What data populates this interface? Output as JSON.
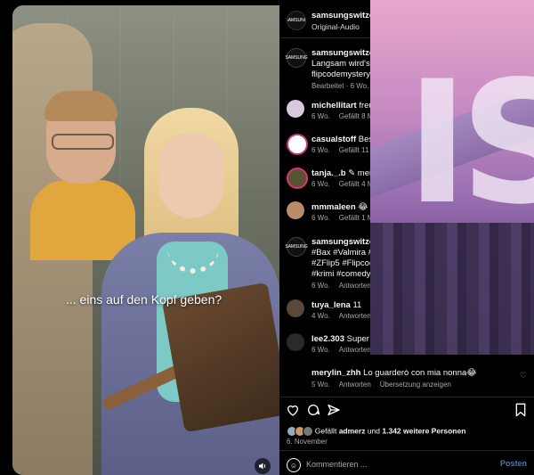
{
  "video": {
    "subtitle": "... eins auf den Kopf geben?",
    "mute_icon": "speaker-icon"
  },
  "header": {
    "username": "samsungswitzerla",
    "audio": "Original-Audio",
    "avatar_text": "SAMSUNG"
  },
  "caption": {
    "username": "samsungswitzerl",
    "line1": "Langsam wird's u",
    "line2": "flipcodemystery.c",
    "meta": "Bearbeitet · 6 Wo."
  },
  "comments": [
    {
      "user": "michellitart",
      "text": "freu r",
      "age": "6 Wo.",
      "likes": "Gefällt 8 Mal"
    },
    {
      "user": "casualstoff",
      "text": "Beste",
      "age": "6 Wo.",
      "likes": "Gefällt 11 Ma"
    },
    {
      "user": "tanja._.b",
      "text": "✎ meist",
      "age": "6 Wo.",
      "likes": "Gefällt 4 Mal"
    },
    {
      "user": "mmmaleen",
      "text": "😂 Bin",
      "age": "6 Wo.",
      "likes": "Gefällt 1 Mal"
    }
  ],
  "samsung_post": {
    "user": "samsungswitzerl",
    "line1": "#Bax #Valmira #",
    "line2": "#ZFlip5 #Flipcod",
    "line3": "#krimi #comedy",
    "age": "6 Wo.",
    "reply": "Antworten"
  },
  "comments2": [
    {
      "user": "tuya_lena",
      "text": "11",
      "age": "4 Wo.",
      "reply": "Antworten"
    },
    {
      "user": "lee2.303",
      "text": "Super",
      "age": "6 Wo.",
      "reply": "Antworten"
    },
    {
      "user": "merylin_zhh",
      "text": "Lo guarderò con mia nonna😂",
      "age": "5 Wo.",
      "reply": "Antworten",
      "translate": "Übersetzung anzeigen"
    }
  ],
  "footer": {
    "likes_prefix": "Gefällt",
    "liker": "admerz",
    "likes_mid": "und",
    "likes_count": "1.342 weitere Personen",
    "date": "6. November",
    "comment_placeholder": "Kommentieren ...",
    "post_label": "Posten"
  },
  "icons": {
    "like": "heart-icon",
    "comment": "comment-icon",
    "share": "paper-plane-icon",
    "save": "bookmark-icon",
    "emoji": "emoji-icon"
  },
  "colors": {
    "background": "#000000",
    "text": "#f5f5f5",
    "muted": "#a8a8a8",
    "post_button": "#4b79a8"
  }
}
